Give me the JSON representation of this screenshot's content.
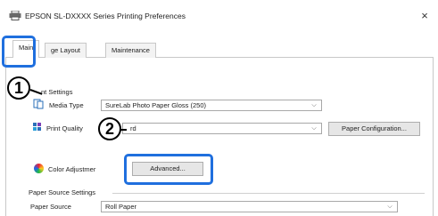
{
  "window": {
    "title": "EPSON SL-DXXXX Series Printing Preferences",
    "close_glyph": "×"
  },
  "tabs": [
    {
      "label": "Main",
      "active": true
    },
    {
      "label": "ge Layout",
      "active": false
    },
    {
      "label": "Maintenance",
      "active": false
    }
  ],
  "print_settings": {
    "section_label": "nt Settings",
    "media_type_label": "Media Type",
    "media_type_value": "SureLab Photo Paper Gloss (250)",
    "print_quality_label": "Print Quality",
    "print_quality_value": "rd",
    "paper_config_button": "Paper Configuration..."
  },
  "color": {
    "label": "Color Adjustmer",
    "advanced_button": "Advanced..."
  },
  "paper_source": {
    "section_label": "Paper Source Settings",
    "source_label": "Paper Source",
    "source_value": "Roll Paper"
  },
  "callouts": [
    "1",
    "2"
  ],
  "colors": {
    "highlight": "#1f6fde",
    "callout_border": "#000000"
  },
  "icons": {
    "title": "printer-icon",
    "media": "media-type-icon",
    "quality": "print-quality-icon",
    "color": "color-wheel-icon",
    "caret": "chevron-down-icon"
  }
}
